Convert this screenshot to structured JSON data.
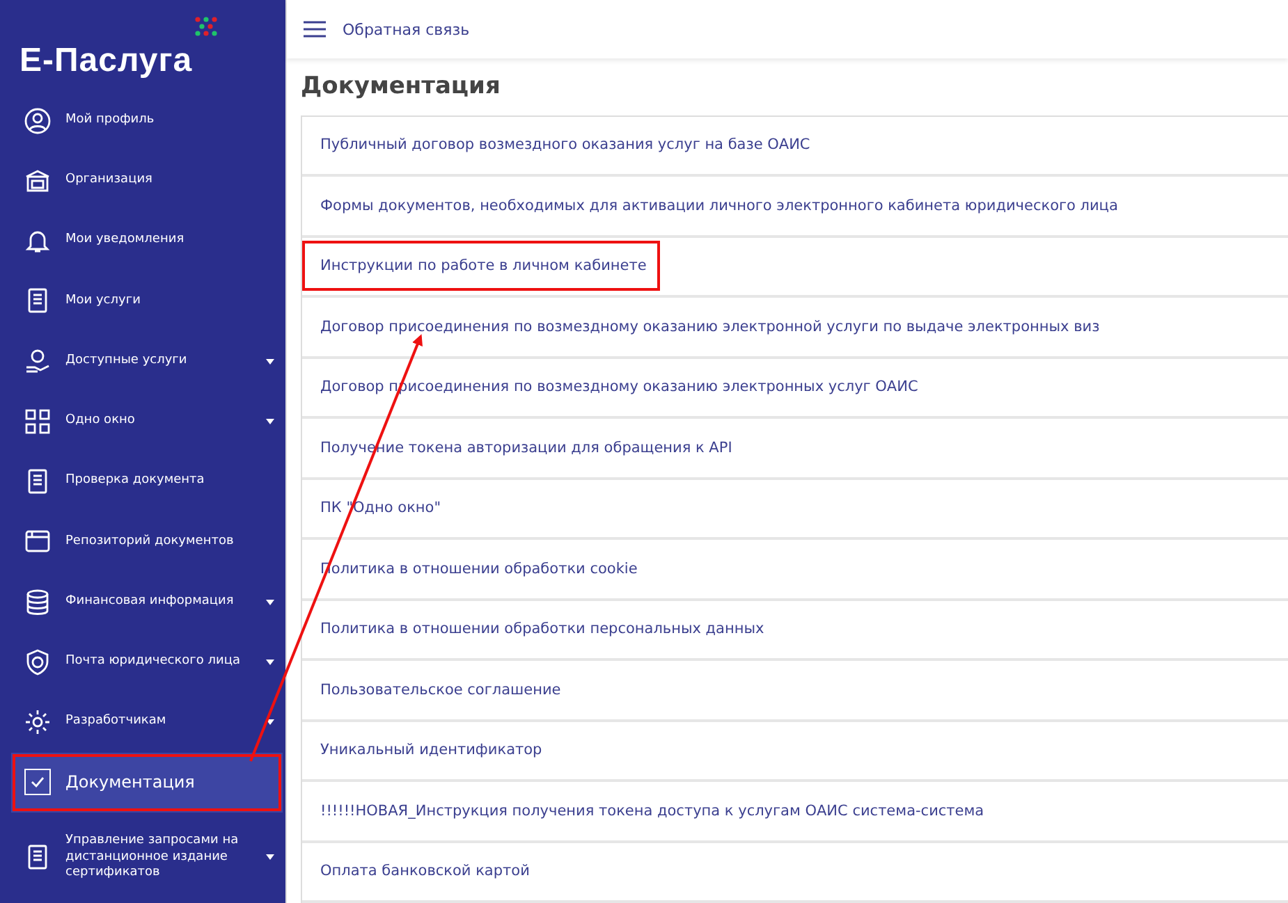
{
  "logo": {
    "text": "Е-Паслуга"
  },
  "sidebar": {
    "items": [
      {
        "label": "Мой профиль",
        "selected": false,
        "expandable": false,
        "annotated": false
      },
      {
        "label": "Организация",
        "selected": false,
        "expandable": false,
        "annotated": false
      },
      {
        "label": "Мои уведомления",
        "selected": false,
        "expandable": false,
        "annotated": false
      },
      {
        "label": "Мои услуги",
        "selected": false,
        "expandable": false,
        "annotated": false
      },
      {
        "label": "Доступные услуги",
        "selected": false,
        "expandable": true,
        "annotated": false
      },
      {
        "label": "Одно окно",
        "selected": false,
        "expandable": true,
        "annotated": false
      },
      {
        "label": "Проверка документа",
        "selected": false,
        "expandable": false,
        "annotated": false
      },
      {
        "label": "Репозиторий документов",
        "selected": false,
        "expandable": false,
        "annotated": false
      },
      {
        "label": "Финансовая информация",
        "selected": false,
        "expandable": true,
        "annotated": false
      },
      {
        "label": "Почта юридического лица",
        "selected": false,
        "expandable": true,
        "annotated": false
      },
      {
        "label": "Разработчикам",
        "selected": false,
        "expandable": true,
        "annotated": false
      },
      {
        "label": "Документация",
        "selected": true,
        "expandable": false,
        "annotated": true
      },
      {
        "label": "Управление запросами на дистанционное издание сертификатов",
        "selected": false,
        "expandable": true,
        "annotated": false
      }
    ]
  },
  "topbar": {
    "link": "Обратная связь"
  },
  "page": {
    "title": "Документация",
    "documents": [
      {
        "title": "Публичный договор возмездного оказания услуг на базе ОАИС",
        "annotated": false
      },
      {
        "title": "Формы документов, необходимых для активации личного электронного кабинета юридического лица",
        "annotated": false
      },
      {
        "title": "Инструкции по работе в личном кабинете",
        "annotated": true
      },
      {
        "title": "Договор присоединения по возмездному оказанию электронной услуги по выдаче электронных виз",
        "annotated": false
      },
      {
        "title": "Договор присоединения по возмездному оказанию электронных услуг ОАИС",
        "annotated": false
      },
      {
        "title": "Получение токена авторизации для обращения к API",
        "annotated": false
      },
      {
        "title": "ПК \"Одно окно\"",
        "annotated": false
      },
      {
        "title": "Политика в отношении обработки cookie",
        "annotated": false
      },
      {
        "title": "Политика в отношении обработки персональных данных",
        "annotated": false
      },
      {
        "title": "Пользовательское соглашение",
        "annotated": false
      },
      {
        "title": "Уникальный идентификатор",
        "annotated": false
      },
      {
        "title": "!!!!!!НОВАЯ_Инструкция получения токена доступа к услугам ОАИС система-система",
        "annotated": false
      },
      {
        "title": "Оплата банковской картой",
        "annotated": false
      }
    ]
  }
}
